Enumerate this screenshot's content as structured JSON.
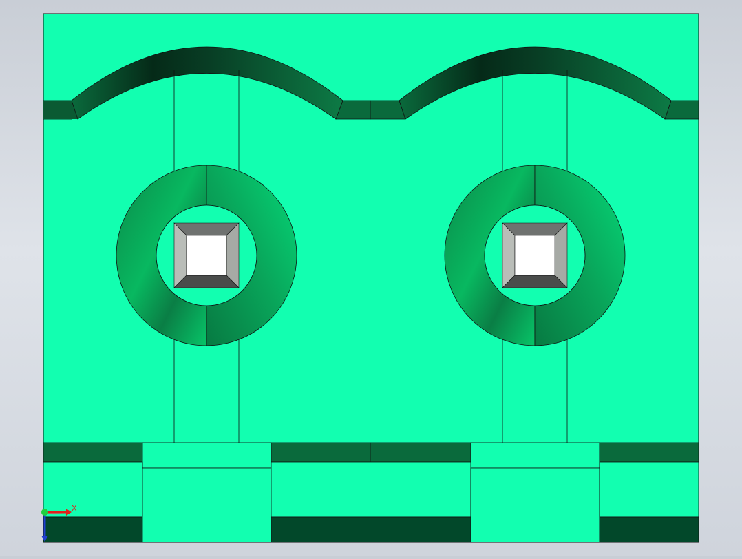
{
  "view": {
    "model_face_color": "#12ffb0",
    "dark_band_color": "#0a6a3c",
    "darkest_band_color": "#02482a",
    "edge_color": "#111111",
    "background_top": "#c9ced6",
    "background_bottom": "#cfd4dc"
  },
  "triad": {
    "x_label": "X",
    "x_axis_color": "#e0201a",
    "y_axis_color": "#1f3fd0",
    "origin_color": "#1fd03f"
  }
}
